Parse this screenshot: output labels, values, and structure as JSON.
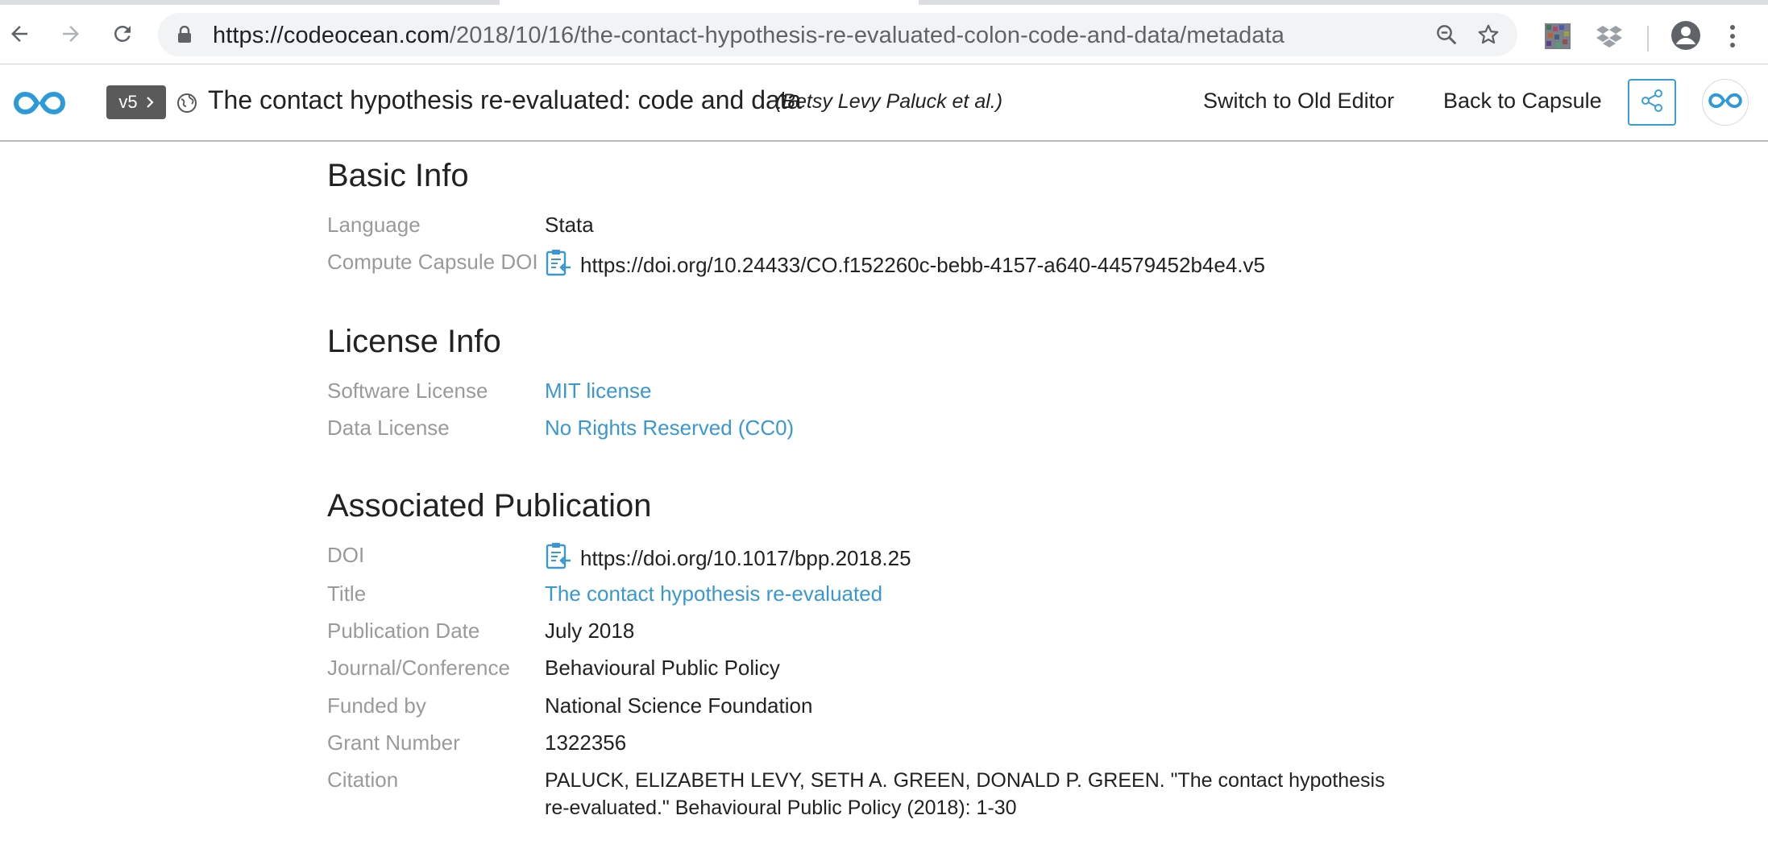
{
  "browser": {
    "url_host": "https://codeocean.com",
    "url_path": "/2018/10/16/the-contact-hypothesis-re-evaluated-colon-code-and-data/metadata",
    "icons": [
      "back-icon",
      "forward-icon",
      "reload-icon",
      "lock-icon",
      "zoom-icon",
      "star-icon",
      "extension-icon",
      "dropbox-icon",
      "account-icon",
      "menu-icon"
    ]
  },
  "header": {
    "version": "v5",
    "title": "The contact hypothesis re-evaluated: code and data",
    "authors": "(Betsy Levy Paluck et al.)",
    "switch_editor": "Switch to Old Editor",
    "back_to_capsule": "Back to Capsule"
  },
  "basic_info": {
    "title": "Basic Info",
    "language_label": "Language",
    "language": "Stata",
    "doi_label": "Compute Capsule DOI",
    "doi": "https://doi.org/10.24433/CO.f152260c-bebb-4157-a640-44579452b4e4.v5"
  },
  "license_info": {
    "title": "License Info",
    "software_label": "Software License",
    "software": "MIT license",
    "data_label": "Data License",
    "data": "No Rights Reserved (CC0)"
  },
  "publication": {
    "title": "Associated Publication",
    "doi_label": "DOI",
    "doi": "https://doi.org/10.1017/bpp.2018.25",
    "pub_title_label": "Title",
    "pub_title": "The contact hypothesis re-evaluated",
    "date_label": "Publication Date",
    "date": "July 2018",
    "journal_label": "Journal/Conference",
    "journal": "Behavioural Public Policy",
    "funded_label": "Funded by",
    "funded": "National Science Foundation",
    "grant_label": "Grant Number",
    "grant": "1322356",
    "citation_label": "Citation",
    "citation": "PALUCK, ELIZABETH LEVY, SETH A. GREEN, DONALD P. GREEN. \"The contact hypothesis re-evaluated.\" Behavioural Public Policy (2018): 1-30"
  },
  "colors": {
    "accent": "#3a98cf",
    "label_gray": "#9a9a9a",
    "badge": "#5a5a5a"
  }
}
